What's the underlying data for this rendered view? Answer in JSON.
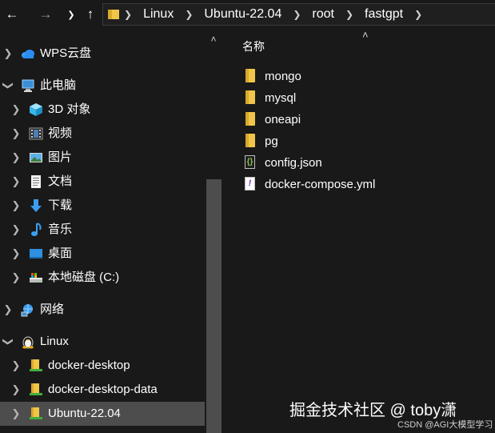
{
  "address_bar": {
    "crumbs": [
      "Linux",
      "Ubuntu-22.04",
      "root",
      "fastgpt"
    ]
  },
  "sidebar": {
    "items": [
      {
        "label": "WPS云盘",
        "icon": "cloud-icon"
      },
      {
        "label": "此电脑",
        "icon": "computer-icon"
      },
      {
        "label": "3D 对象",
        "icon": "cube-3d-icon"
      },
      {
        "label": "视频",
        "icon": "video-icon"
      },
      {
        "label": "图片",
        "icon": "picture-icon"
      },
      {
        "label": "文档",
        "icon": "document-icon"
      },
      {
        "label": "下载",
        "icon": "download-icon"
      },
      {
        "label": "音乐",
        "icon": "music-icon"
      },
      {
        "label": "桌面",
        "icon": "desktop-icon"
      },
      {
        "label": "本地磁盘 (C:)",
        "icon": "drive-icon"
      },
      {
        "label": "网络",
        "icon": "network-icon"
      },
      {
        "label": "Linux",
        "icon": "linux-penguin-icon"
      },
      {
        "label": "docker-desktop",
        "icon": "linux-folder-icon"
      },
      {
        "label": "docker-desktop-data",
        "icon": "linux-folder-icon"
      },
      {
        "label": "Ubuntu-22.04",
        "icon": "linux-folder-icon",
        "selected": true
      }
    ]
  },
  "main": {
    "column_header": "名称",
    "files": [
      {
        "name": "mongo",
        "type": "folder"
      },
      {
        "name": "mysql",
        "type": "folder"
      },
      {
        "name": "oneapi",
        "type": "folder"
      },
      {
        "name": "pg",
        "type": "folder"
      },
      {
        "name": "config.json",
        "type": "json"
      },
      {
        "name": "docker-compose.yml",
        "type": "yml"
      }
    ]
  },
  "watermark": {
    "main": "掘金技术社区 @ toby潇",
    "sub": "CSDN @AGI大模型学习"
  },
  "colors": {
    "background": "#191919",
    "selection": "#4d4d4d",
    "folder": "#f0c64a",
    "text": "#ffffff"
  }
}
